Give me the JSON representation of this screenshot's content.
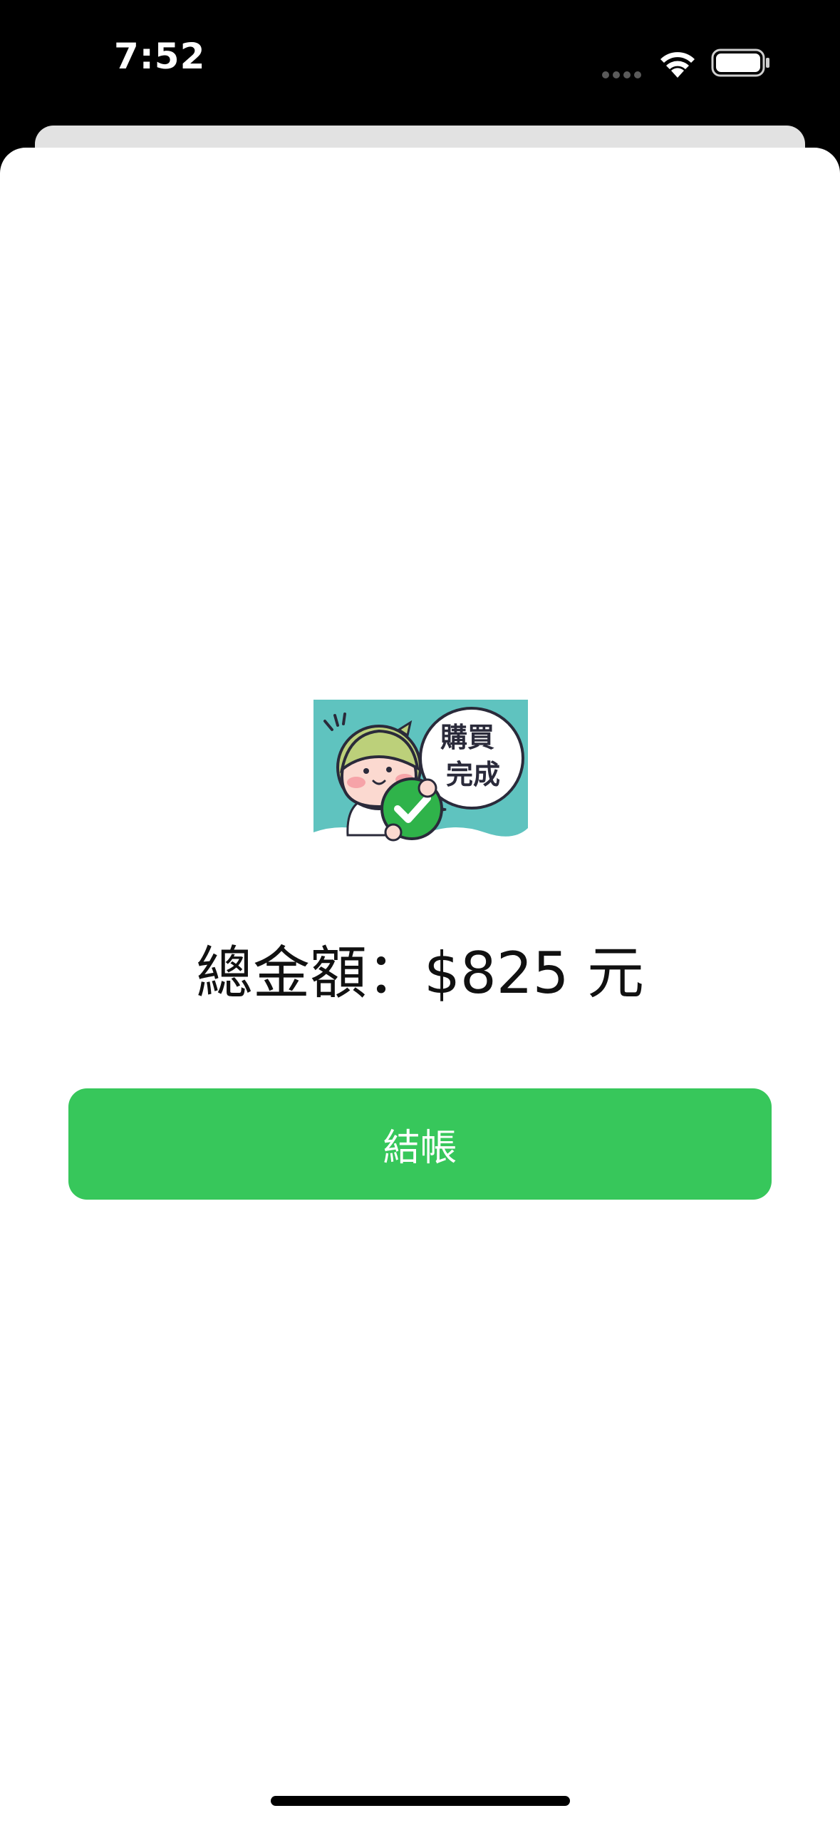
{
  "status_bar": {
    "time": "7:52",
    "icons": [
      "cellular-signal-icon",
      "wifi-icon",
      "battery-icon"
    ]
  },
  "illustration": {
    "name": "purchase-complete-sticker",
    "bubble_text": [
      "購買",
      "完成"
    ],
    "colors": {
      "background": "#5fc3bf",
      "check": "#2fb34a"
    }
  },
  "summary": {
    "total_text": "總金額：$825 元"
  },
  "actions": {
    "checkout_label": "結帳"
  },
  "theme": {
    "accent": "#37c75b",
    "sheet_background": "#ffffff"
  }
}
